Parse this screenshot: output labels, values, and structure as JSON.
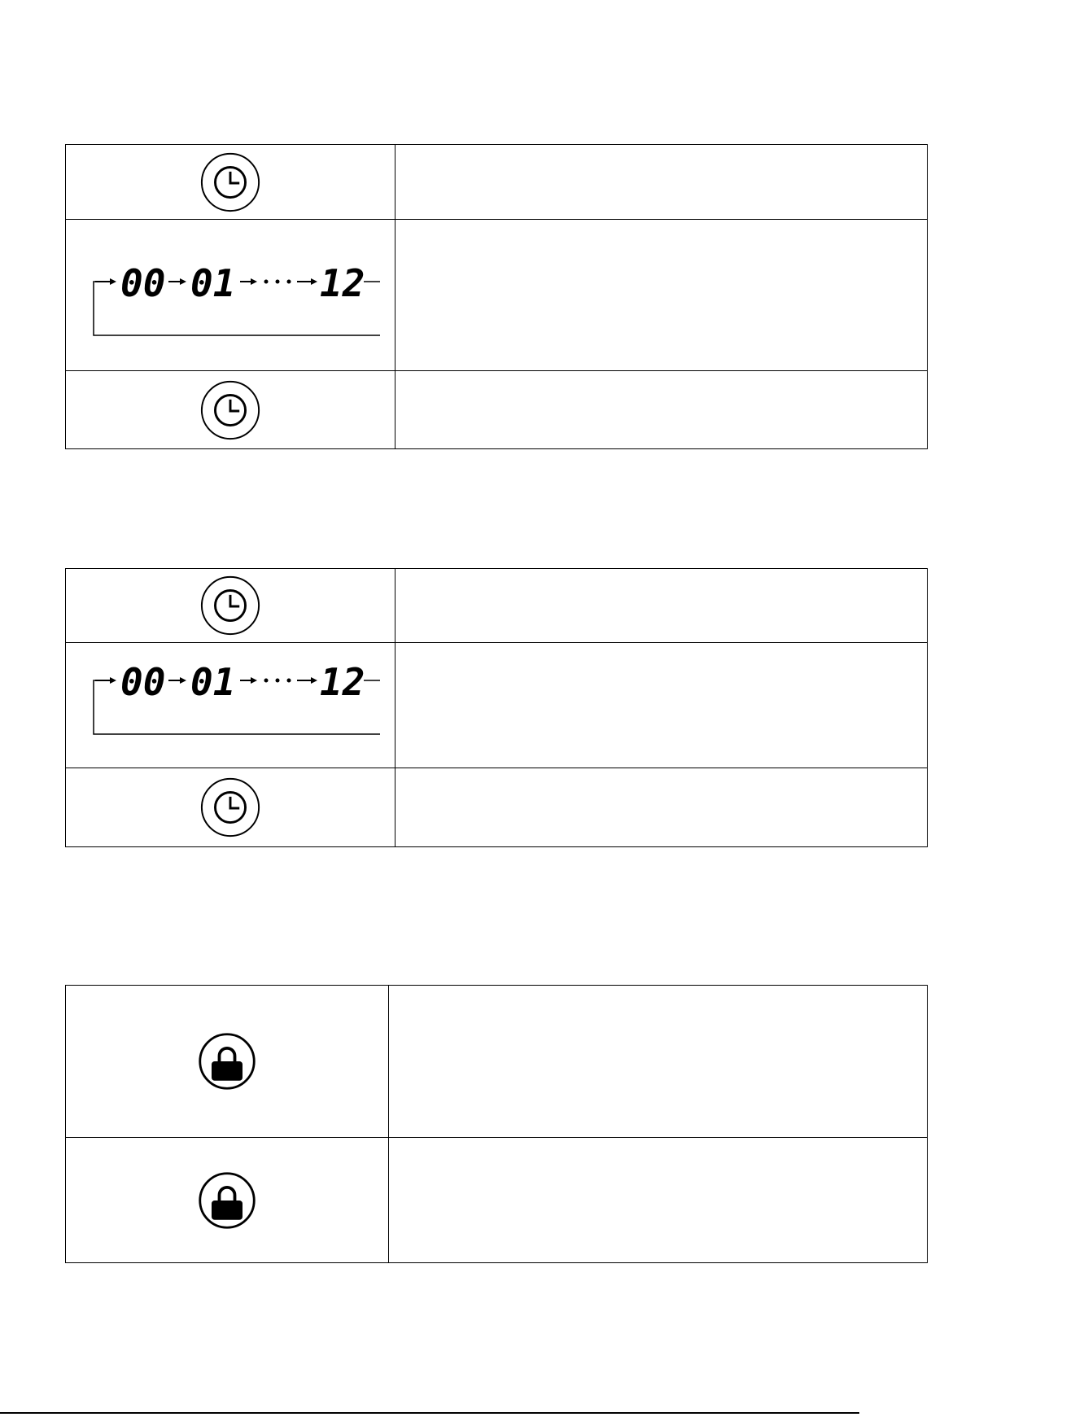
{
  "tables": [
    {
      "rows": [
        {
          "icon": "clock-button-icon"
        },
        {
          "icon": "timer-sequence-display",
          "sequence": [
            "00",
            "01",
            "...",
            "12"
          ]
        },
        {
          "icon": "clock-button-icon"
        }
      ]
    },
    {
      "rows": [
        {
          "icon": "clock-button-icon"
        },
        {
          "icon": "timer-sequence-display",
          "sequence": [
            "00",
            "01",
            "...",
            "12"
          ]
        },
        {
          "icon": "clock-button-icon"
        }
      ]
    },
    {
      "rows": [
        {
          "icon": "lock-button-icon"
        },
        {
          "icon": "lock-button-icon"
        }
      ]
    }
  ]
}
